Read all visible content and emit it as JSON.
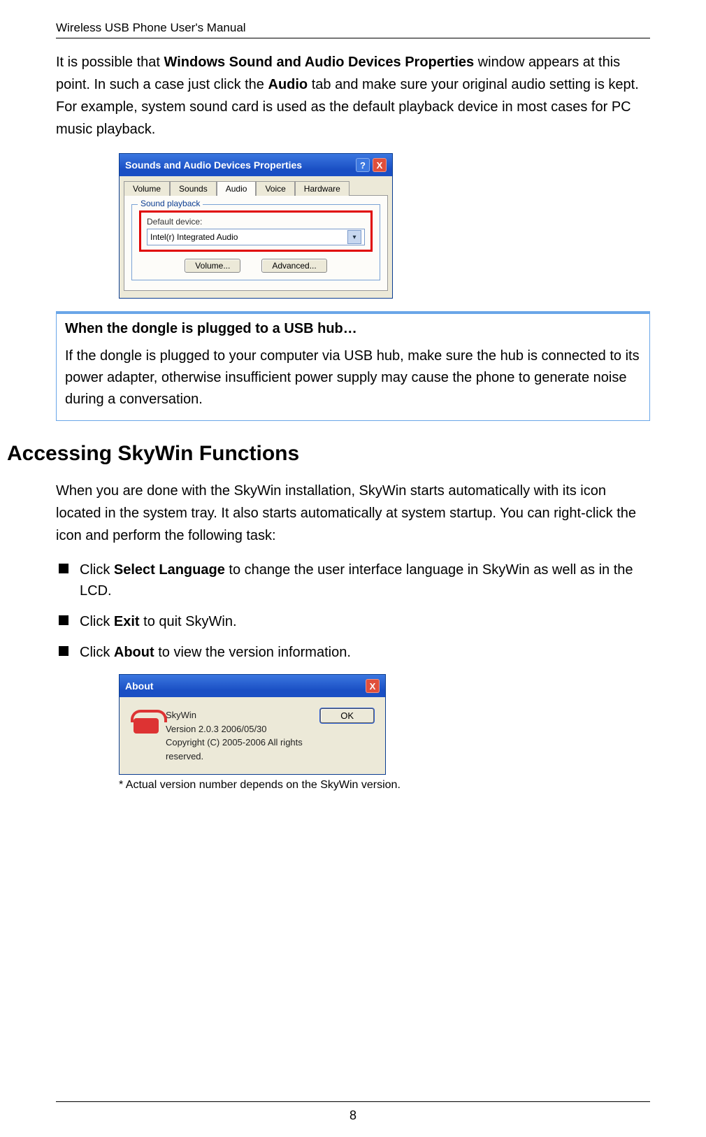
{
  "header": {
    "title": "Wireless USB Phone User's Manual"
  },
  "para1": {
    "pre": "It is possible that ",
    "b1": "Windows Sound and Audio Devices Properties",
    "mid1": " window appears at this point. In such a case just click the ",
    "b2": "Audio",
    "mid2": " tab and make sure your original audio setting is kept. For example, system sound card is used as the default playback device in most cases for PC music playback."
  },
  "dialog1": {
    "title": "Sounds and Audio Devices Properties",
    "help": "?",
    "close": "X",
    "tabs": [
      "Volume",
      "Sounds",
      "Audio",
      "Voice",
      "Hardware"
    ],
    "group_legend": "Sound playback",
    "field_label": "Default device:",
    "combo_value": "Intel(r) Integrated Audio",
    "btn_volume": "Volume...",
    "btn_advanced": "Advanced..."
  },
  "callout": {
    "title": "When the dongle is plugged to a USB hub…",
    "body": "If the dongle is plugged to your computer via USB hub, make sure the hub is connected to its power adapter, otherwise insufficient power supply may cause the phone to generate noise during a conversation."
  },
  "section_heading": "Accessing SkyWin Functions",
  "para2": "When you are done with the SkyWin installation, SkyWin starts automatically with its icon located in the system tray. It also starts automatically at system startup. You can right-click the icon and perform the following task:",
  "bullets": {
    "b1_pre": "Click ",
    "b1_bold": "Select Language",
    "b1_post": " to change the user interface language in SkyWin as well as in the LCD.",
    "b2_pre": "Click ",
    "b2_bold": "Exit",
    "b2_post": " to quit SkyWin.",
    "b3_pre": "Click ",
    "b3_bold": "About",
    "b3_post": " to view the version information."
  },
  "dialog2": {
    "title": "About",
    "close": "X",
    "line1": "SkyWin",
    "line2": "Version 2.0.3  2006/05/30",
    "line3": "Copyright (C) 2005-2006 All rights reserved.",
    "ok": "OK"
  },
  "footnote": "* Actual version number depends on the SkyWin version.",
  "page_number": "8"
}
